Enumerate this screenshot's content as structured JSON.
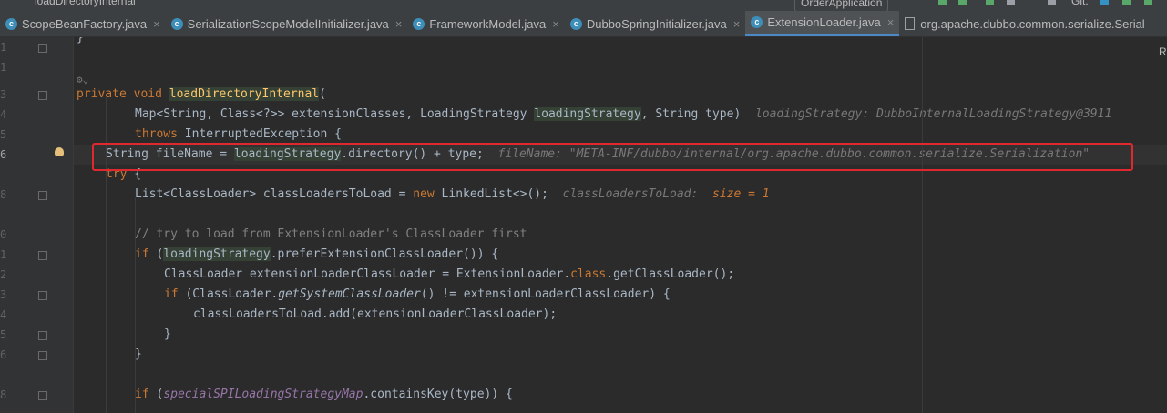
{
  "window": {
    "title": "loadDirectoryInternal"
  },
  "toolbar": {
    "run_config": "OrderApplication",
    "git_label": "Git:"
  },
  "tabs": [
    {
      "label": "ScopeBeanFactory.java",
      "icon": "class-icon",
      "closable": true
    },
    {
      "label": "SerializationScopeModelInitializer.java",
      "icon": "class-icon",
      "closable": true
    },
    {
      "label": "FrameworkModel.java",
      "icon": "class-icon",
      "closable": true
    },
    {
      "label": "DubboSpringInitializer.java",
      "icon": "class-icon",
      "closable": true
    },
    {
      "label": "ExtensionLoader.java",
      "icon": "class-icon",
      "closable": true,
      "active": true
    },
    {
      "label": "org.apache.dubbo.common.serialize.Serial",
      "icon": "file-icon",
      "closable": false
    }
  ],
  "gutter": {
    "line_numbers": [
      "1",
      "1",
      "",
      "3",
      "4",
      "5",
      "6",
      "",
      "8",
      "",
      "0",
      "1",
      "2",
      "3",
      "4",
      "5",
      "6",
      "",
      "8"
    ]
  },
  "code": {
    "l0": "}",
    "l3_kw1": "private",
    "l3_kw2": "void",
    "l3_fn": "loadDirectoryInternal",
    "l3_rest": "(",
    "l4_a": "Map<String, Class<?>> extensionClasses, LoadingStrategy ",
    "l4_b": "loadingStrategy",
    "l4_c": ", String type)",
    "l4_hint": "loadingStrategy: DubboInternalLoadingStrategy@3911",
    "l5_kw": "throws",
    "l5_rest": " InterruptedException {",
    "l6_a": "String fileName = ",
    "l6_b": "loadingStrategy",
    "l6_c": ".directory() + type;",
    "l6_hint": "fileName: \"META-INF/dubbo/internal/org.apache.dubbo.common.serialize.Serialization\"",
    "l7_kw": "try",
    "l7_rest": " {",
    "l8_a": "List<ClassLoader> classLoadersToLoad = ",
    "l8_kw": "new",
    "l8_b": " LinkedList<>();",
    "l8_hint": "classLoadersToLoad:",
    "l8_hint_val": "size = 1",
    "l10_cm": "// try to load from ExtensionLoader's ClassLoader first",
    "l11_kw": "if",
    "l11_a": " (",
    "l11_b": "loadingStrategy",
    "l11_c": ".preferExtensionClassLoader()) {",
    "l12_a": "ClassLoader extensionLoaderClassLoader = ExtensionLoader.",
    "l12_kw": "class",
    "l12_b": ".getClassLoader();",
    "l13_kw": "if",
    "l13_a": " (ClassLoader.",
    "l13_it": "getSystemClassLoader",
    "l13_b": "() != extensionLoaderClassLoader) {",
    "l14": "classLoadersToLoad.add(extensionLoaderClassLoader);",
    "l15": "}",
    "l16": "}",
    "l18_kw": "if",
    "l18_a": " (",
    "l18_st": "specialSPILoadingStrategyMap",
    "l18_b": ".containsKey(type)) {"
  },
  "colors": {
    "keyword": "#cc7832",
    "function": "#ffc66d",
    "comment": "#808080",
    "highlight_box": "#e0292e",
    "tab_underline": "#4a88c7"
  }
}
